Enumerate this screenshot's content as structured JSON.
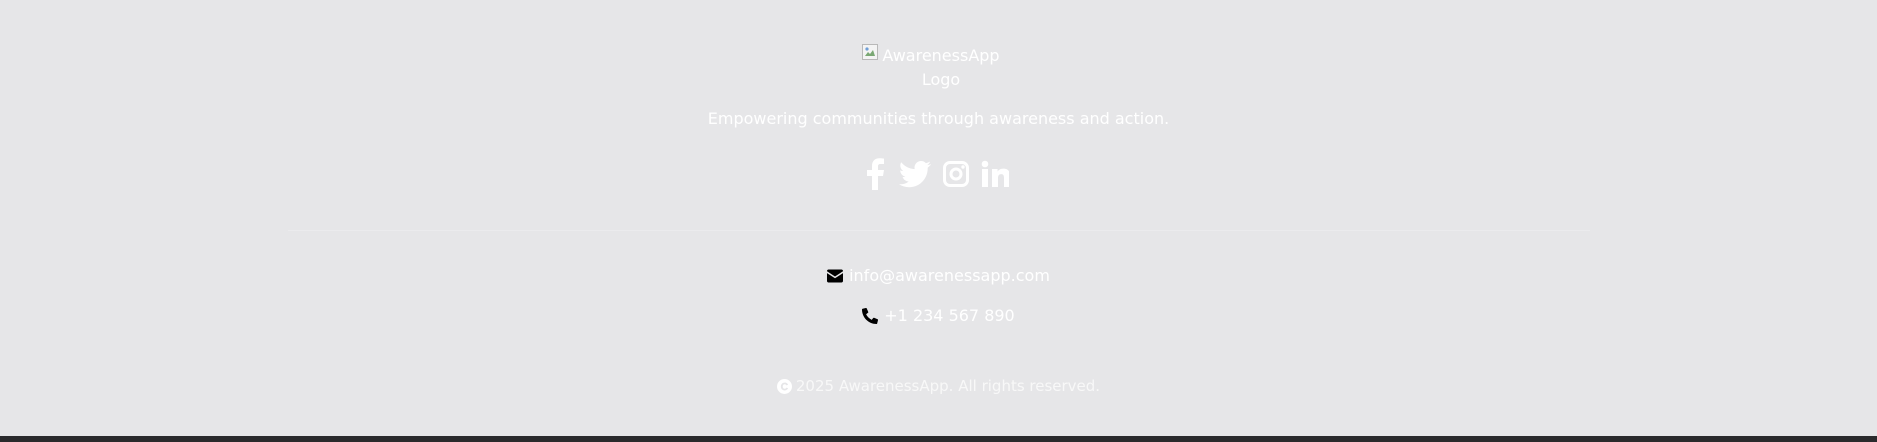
{
  "footer": {
    "logo_alt": "AwarenessApp Logo",
    "tagline": "Empowering communities through awareness and action.",
    "social": [
      {
        "name": "facebook",
        "icon": "facebook-icon"
      },
      {
        "name": "twitter",
        "icon": "twitter-icon"
      },
      {
        "name": "instagram",
        "icon": "instagram-icon"
      },
      {
        "name": "linkedin",
        "icon": "linkedin-icon"
      }
    ],
    "contact": {
      "email": "info@awarenessapp.com",
      "email_icon": "envelope-icon",
      "phone": "+1 234 567 890",
      "phone_icon": "phone-icon"
    },
    "copyright": "2025 AwarenessApp. All rights reserved.",
    "copyright_icon": "copyright-icon"
  },
  "colors": {
    "background": "#e6e6e8",
    "text": "#ffffff",
    "bottom_bar": "#2a2a2c"
  }
}
